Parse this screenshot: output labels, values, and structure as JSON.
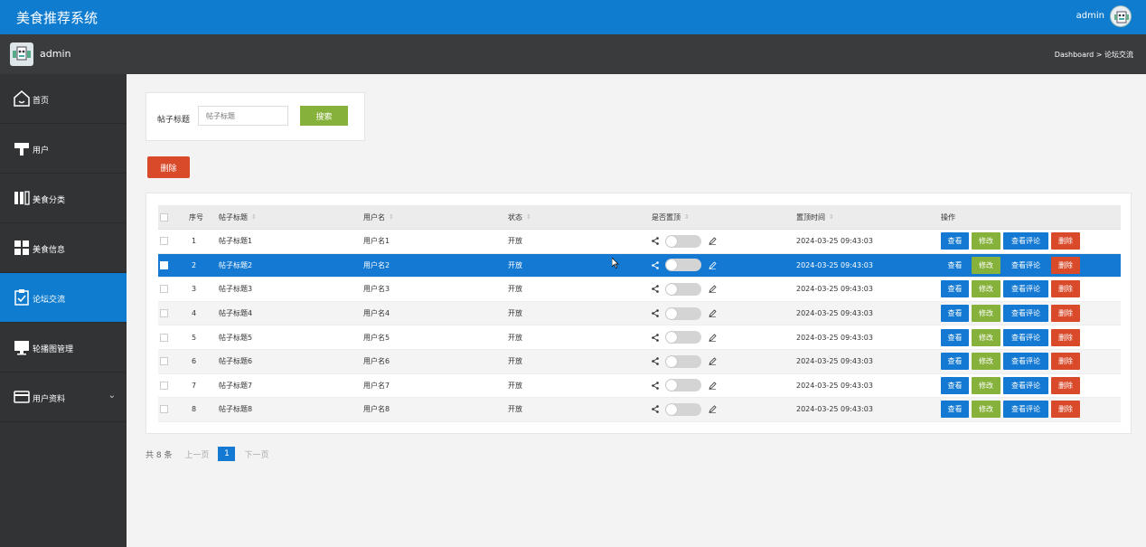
{
  "app": {
    "title": "美食推荐系统"
  },
  "topbar": {
    "username": "admin"
  },
  "subbar": {
    "username": "admin",
    "breadcrumb": "Dashboard > 论坛交流"
  },
  "sidebar": {
    "items": [
      {
        "label": "首页",
        "icon": "home-icon"
      },
      {
        "label": "用户",
        "icon": "user-icon"
      },
      {
        "label": "美食分类",
        "icon": "category-icon"
      },
      {
        "label": "美食信息",
        "icon": "grid-icon"
      },
      {
        "label": "论坛交流",
        "icon": "clipboard-icon",
        "active": true
      },
      {
        "label": "轮播图管理",
        "icon": "monitor-icon"
      },
      {
        "label": "用户资料",
        "icon": "card-icon",
        "chevron": "⌄"
      }
    ]
  },
  "search": {
    "label": "帖子标题",
    "placeholder": "帖子标题",
    "button": "搜索"
  },
  "actions": {
    "delete": "删除"
  },
  "table": {
    "headers": {
      "index": "序号",
      "title": "帖子标题",
      "username": "用户名",
      "status": "状态",
      "pinned": "是否置顶",
      "pin_time": "置顶时间",
      "ops": "操作"
    },
    "row_buttons": {
      "view": "查看",
      "edit": "修改",
      "comments": "查看评论",
      "delete": "删除"
    },
    "rows": [
      {
        "index": "1",
        "title": "帖子标题1",
        "username": "用户名1",
        "status": "开放",
        "pinned": false,
        "pin_time": "2024-03-25 09:43:03"
      },
      {
        "index": "2",
        "title": "帖子标题2",
        "username": "用户名2",
        "status": "开放",
        "pinned": false,
        "pin_time": "2024-03-25 09:43:03",
        "selected": true
      },
      {
        "index": "3",
        "title": "帖子标题3",
        "username": "用户名3",
        "status": "开放",
        "pinned": false,
        "pin_time": "2024-03-25 09:43:03"
      },
      {
        "index": "4",
        "title": "帖子标题4",
        "username": "用户名4",
        "status": "开放",
        "pinned": false,
        "pin_time": "2024-03-25 09:43:03"
      },
      {
        "index": "5",
        "title": "帖子标题5",
        "username": "用户名5",
        "status": "开放",
        "pinned": false,
        "pin_time": "2024-03-25 09:43:03"
      },
      {
        "index": "6",
        "title": "帖子标题6",
        "username": "用户名6",
        "status": "开放",
        "pinned": false,
        "pin_time": "2024-03-25 09:43:03"
      },
      {
        "index": "7",
        "title": "帖子标题7",
        "username": "用户名7",
        "status": "开放",
        "pinned": false,
        "pin_time": "2024-03-25 09:43:03"
      },
      {
        "index": "8",
        "title": "帖子标题8",
        "username": "用户名8",
        "status": "开放",
        "pinned": false,
        "pin_time": "2024-03-25 09:43:03"
      }
    ]
  },
  "pagination": {
    "total": "共 8 条",
    "prev": "上一页",
    "current": "1",
    "next": "下一页"
  },
  "colors": {
    "primary": "#0f7ccf",
    "success": "#86b13a",
    "danger": "#d94a2b",
    "sidebar": "#323335"
  }
}
